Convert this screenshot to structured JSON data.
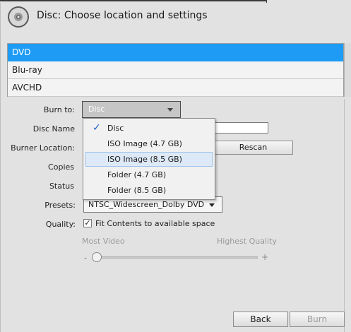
{
  "dialog": {
    "title": "Disc: Choose location and settings",
    "icon": "disc-icon"
  },
  "disc_types": [
    {
      "label": "DVD",
      "selected": true
    },
    {
      "label": "Blu-ray",
      "selected": false
    },
    {
      "label": "AVCHD",
      "selected": false
    }
  ],
  "form": {
    "burn_to_label": "Burn to:",
    "burn_to_value": "Disc",
    "disc_name_label": "Disc Name",
    "disc_name_value": "",
    "burner_location_label": "Burner Location:",
    "rescan_label": "Rescan",
    "copies_label": "Copies",
    "status_label": "Status",
    "presets_label": "Presets:",
    "presets_value": "NTSC_Widescreen_Dolby DVD",
    "quality_label": "Quality:",
    "fit_contents_label": "Fit Contents to available space",
    "fit_contents_checked": true,
    "quality_low_label": "Most Video",
    "quality_high_label": "Highest Quality",
    "quality_minus": "-",
    "quality_plus": "+",
    "quality_level": 0
  },
  "burn_to_menu": {
    "items": [
      {
        "label": "Disc",
        "checked": true
      },
      {
        "label": "ISO Image (4.7 GB)",
        "checked": false
      },
      {
        "label": "ISO Image (8.5 GB)",
        "checked": false,
        "hover": true
      },
      {
        "label": "Folder (4.7 GB)",
        "checked": false
      },
      {
        "label": "Folder (8.5 GB)",
        "checked": false
      }
    ],
    "check_glyph": "✓"
  },
  "footer": {
    "back_label": "Back",
    "burn_label": "Burn"
  },
  "colors": {
    "selection": "#1e9cf5",
    "menu_hover": "#dde9f6",
    "checkmark": "#1f5fc4"
  }
}
